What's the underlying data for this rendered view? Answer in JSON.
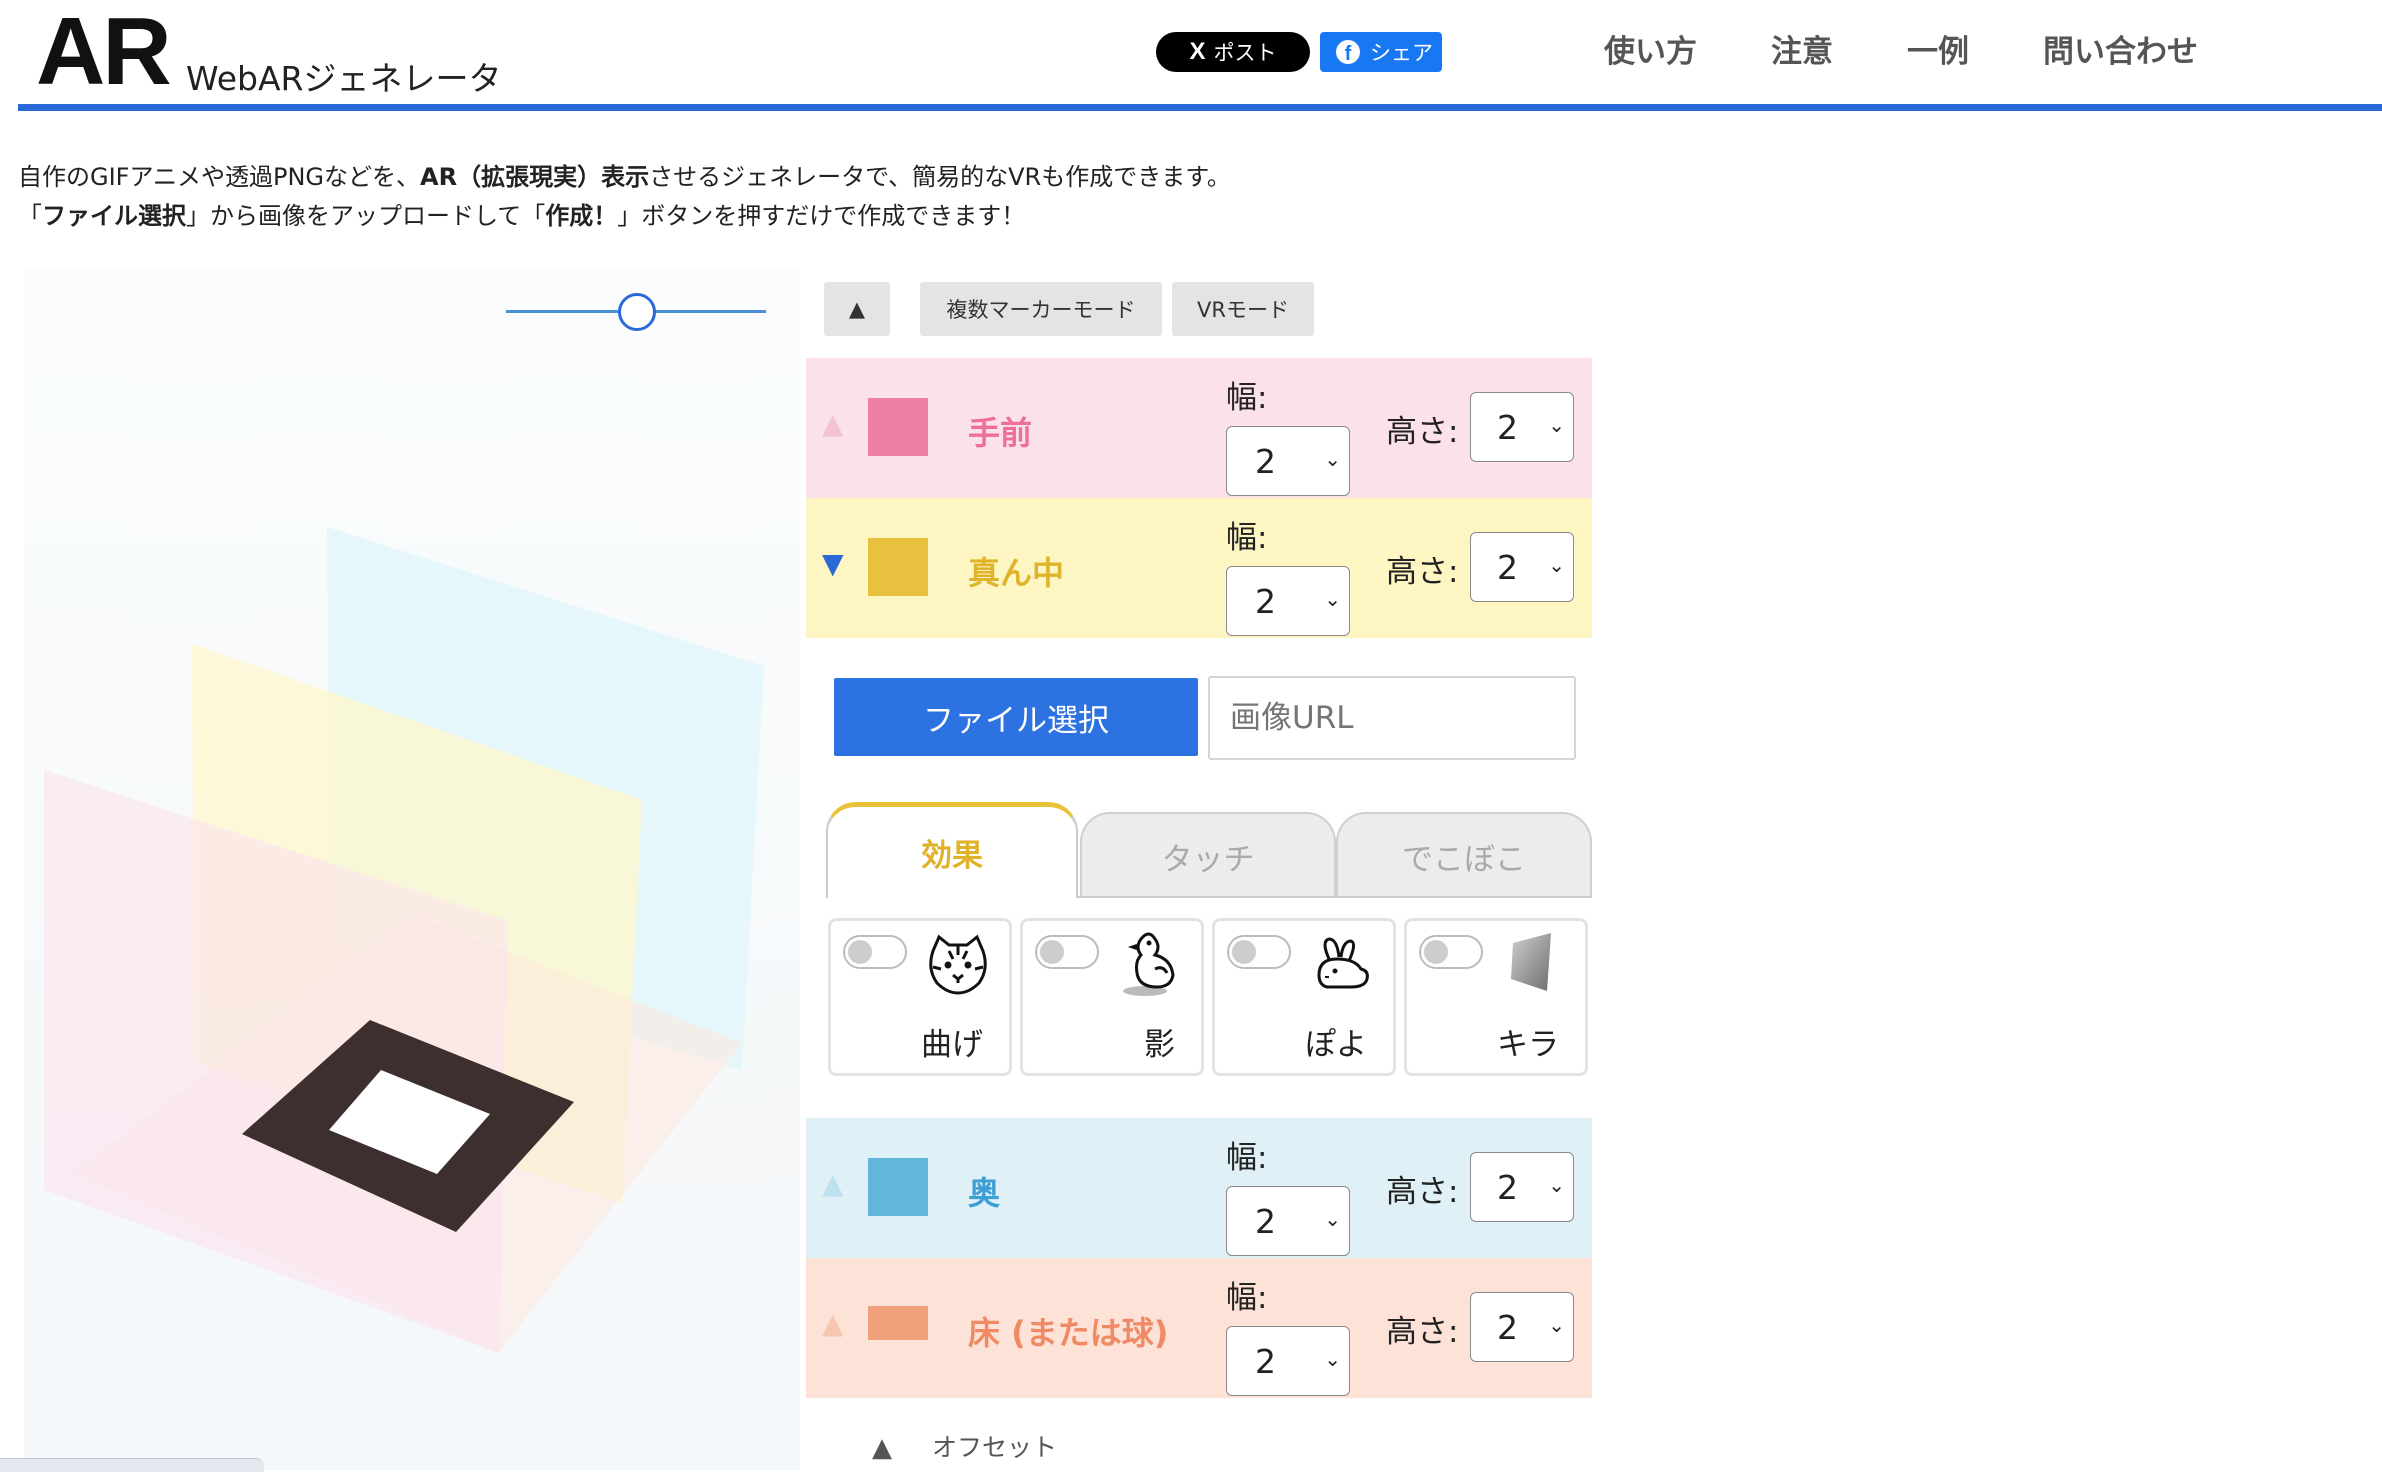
{
  "header": {
    "logo": "AR",
    "logo_sub": "WebARジェネレータ",
    "share_x": "ポスト",
    "share_x_glyph": "X",
    "share_fb": "シェア",
    "nav": [
      "使い方",
      "注意",
      "一例",
      "問い合わせ"
    ]
  },
  "intro": {
    "line1_a": "自作のGIFアニメや透過PNGなどを、",
    "line1_b": "AR（拡張現実）表示",
    "line1_c": "させるジェネレータで、簡易的なVRも作成できます。",
    "line2_a": "「",
    "line2_b": "ファイル選択",
    "line2_c": "」から画像をアップロードして「",
    "line2_d": "作成！",
    "line2_e": "」ボタンを押すだけで作成できます！"
  },
  "toolbar": {
    "collapse": "▲",
    "multi_marker": "複数マーカーモード",
    "vr_mode": "VRモード"
  },
  "labels": {
    "width": "幅:",
    "height": "高さ:"
  },
  "layers": [
    {
      "name": "手前",
      "arrow": "▲",
      "width": "2",
      "height": "2",
      "color": "#f07fa8",
      "bg": "#fbe1ea",
      "label_color": "#ee6f9a",
      "arrow_color": "#f4c3d3"
    },
    {
      "name": "真ん中",
      "arrow": "▼",
      "width": "2",
      "height": "2",
      "color": "#e8c23e",
      "bg": "#fdf6c3",
      "label_color": "#e0b42a",
      "arrow_color": "#2a6ad6"
    },
    {
      "name": "奥",
      "arrow": "▲",
      "width": "2",
      "height": "2",
      "color": "#62b6dc",
      "bg": "#e0f0f7",
      "label_color": "#3b9fd3",
      "arrow_color": "#bfe0ef"
    },
    {
      "name": "床 (または球)",
      "arrow": "▲",
      "width": "2",
      "height": "2",
      "color": "#f1a07c",
      "bg": "#fde2d8",
      "label_color": "#f08a64",
      "arrow_color": "#f6c6b1"
    }
  ],
  "upload": {
    "file_button": "ファイル選択",
    "url_placeholder": "画像URL"
  },
  "tabs": [
    "効果",
    "タッチ",
    "でこぼこ"
  ],
  "effects": [
    {
      "label": "曲げ",
      "icon": "tiger-icon"
    },
    {
      "label": "影",
      "icon": "chick-icon"
    },
    {
      "label": "ぽよ",
      "icon": "rabbit-icon"
    },
    {
      "label": "キラ",
      "icon": "shine-icon"
    }
  ],
  "offset": {
    "arrow": "▲",
    "label": "オフセット"
  },
  "colors": {
    "accent": "#2a6ad6",
    "file_button": "#2c72e0"
  }
}
